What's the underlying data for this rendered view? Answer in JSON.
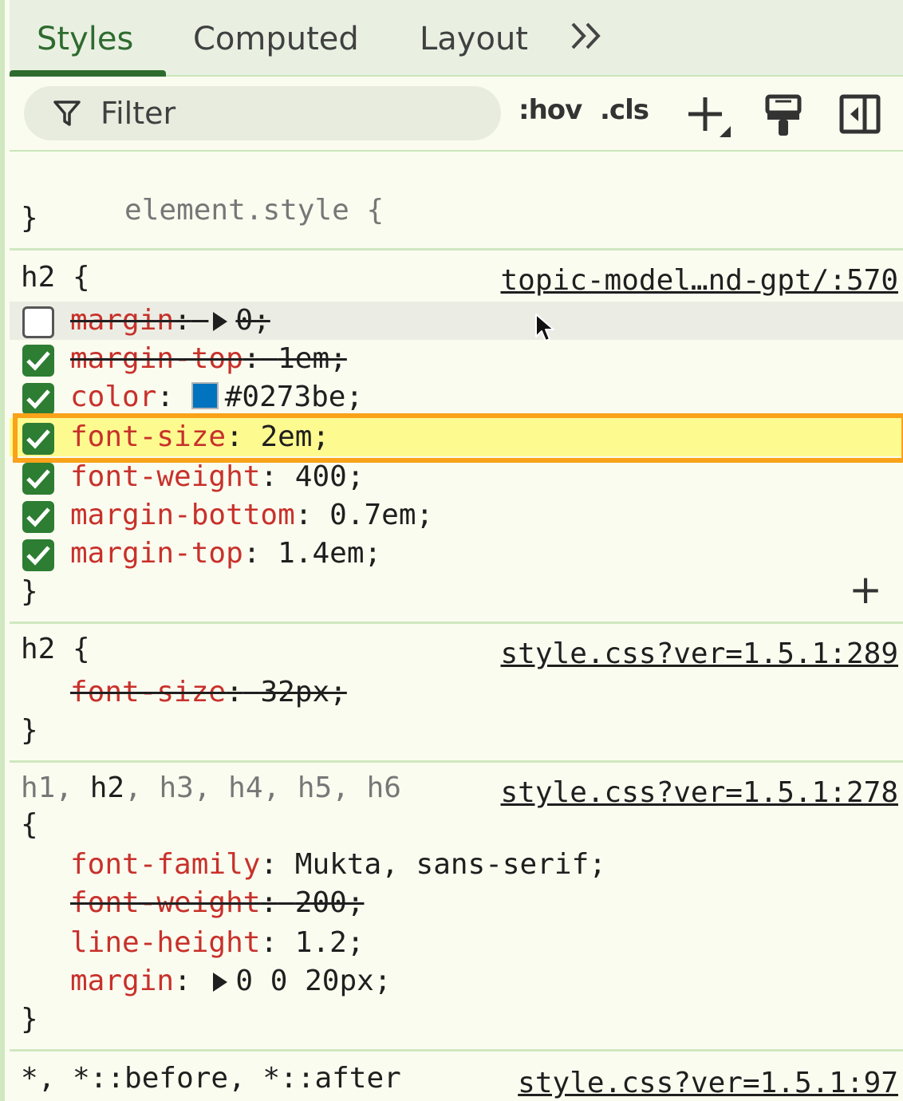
{
  "tabs": [
    {
      "label": "Styles",
      "active": true
    },
    {
      "label": "Computed",
      "active": false
    },
    {
      "label": "Layout",
      "active": false
    }
  ],
  "more_tabs_icon": "double-chevron-right-icon",
  "toolbar": {
    "filter_placeholder": "Filter",
    "hov_label": ":hov",
    "cls_label": ".cls",
    "icons": [
      "filter-icon",
      "plus-new-rule-icon",
      "paint-roller-icon",
      "sidebar-toggle-icon"
    ]
  },
  "colors": {
    "accent": "#2e6b2e",
    "prop_name": "#c8312b",
    "highlight": "#fdfb8f",
    "highlight_border": "#f9a21a",
    "swatch": "#0273be"
  },
  "element_style": {
    "selector": "element.style {",
    "close": "}"
  },
  "rule1": {
    "selector": "h2 {",
    "source": "topic-model…nd-gpt/:570",
    "close": "}",
    "decls": [
      {
        "name": "margin",
        "value": "0;",
        "checked": false
      },
      {
        "name": "margin-top",
        "value": "1em;",
        "checked": true
      },
      {
        "name": "color",
        "value": "#0273be;",
        "checked": true
      },
      {
        "name": "font-size",
        "value": "2em;",
        "checked": true
      },
      {
        "name": "font-weight",
        "value": "400;",
        "checked": true
      },
      {
        "name": "margin-bottom",
        "value": "0.7em;",
        "checked": true
      },
      {
        "name": "margin-top",
        "value": "1.4em;",
        "checked": true
      }
    ]
  },
  "rule2": {
    "selector": "h2 {",
    "source": "style.css?ver=1.5.1:289",
    "close": "}",
    "decls": [
      {
        "name": "font-size",
        "value": "32px;"
      }
    ]
  },
  "rule3": {
    "selectors": [
      "h1",
      "h2",
      "h3",
      "h4",
      "h5",
      "h6"
    ],
    "open": "{",
    "source": "style.css?ver=1.5.1:278",
    "close": "}",
    "decls": [
      {
        "name": "font-family",
        "value": "Mukta, sans-serif;"
      },
      {
        "name": "font-weight",
        "value": "200;"
      },
      {
        "name": "line-height",
        "value": "1.2;"
      },
      {
        "name": "margin",
        "value": "0 0 20px;"
      }
    ]
  },
  "rule4": {
    "selector": "*, *::before, *::after",
    "source": "style.css?ver=1.5.1:97"
  },
  "sep": ":",
  "comma": ", "
}
